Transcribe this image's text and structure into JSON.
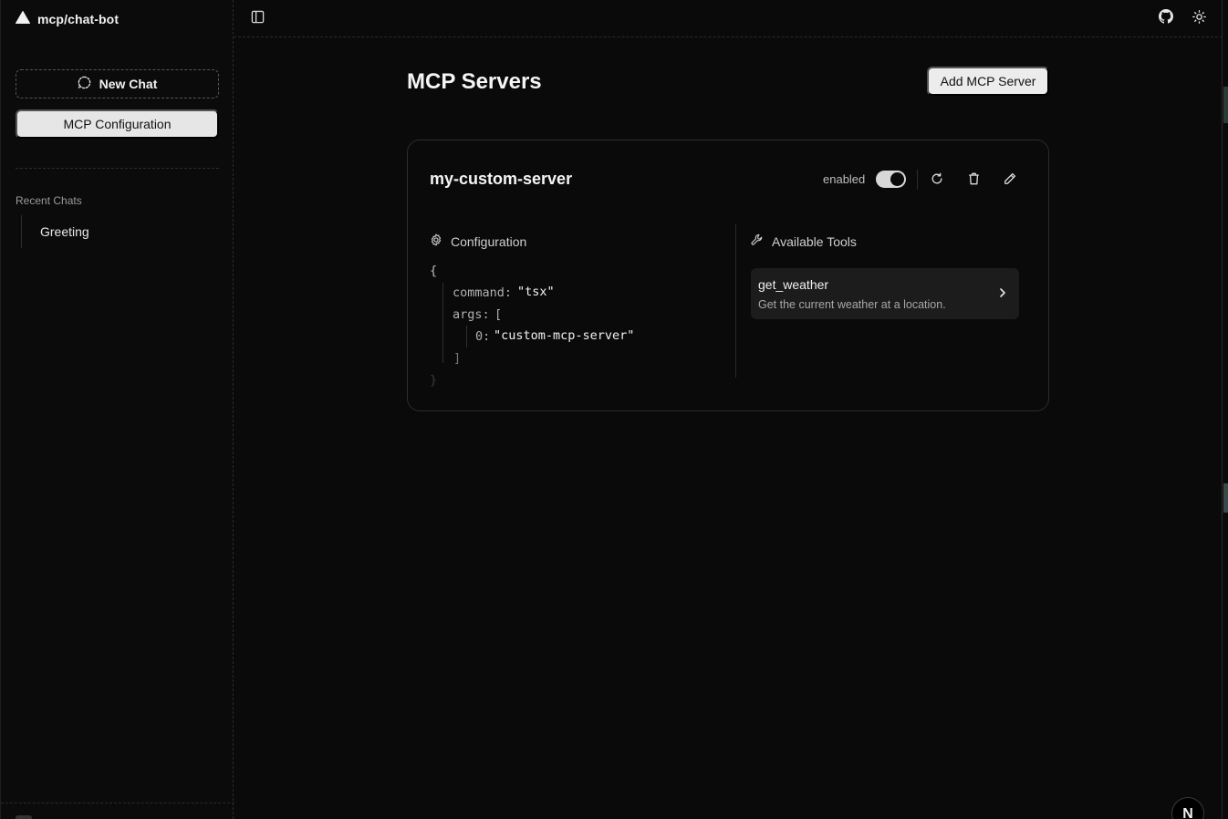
{
  "app": {
    "title": "mcp/chat-bot"
  },
  "sidebar": {
    "new_chat_label": "New Chat",
    "mcp_config_label": "MCP Configuration",
    "recent_label": "Recent Chats",
    "recent_items": [
      {
        "label": "Greeting"
      }
    ]
  },
  "main": {
    "title": "MCP Servers",
    "add_button_label": "Add MCP Server"
  },
  "server": {
    "name": "my-custom-server",
    "status_label": "enabled",
    "enabled": true,
    "configuration_label": "Configuration",
    "tools_label": "Available Tools",
    "config": {
      "open_brace": "{",
      "command_key": "command:",
      "command_value": "\"tsx\"",
      "args_key": "args:",
      "args_open": "[",
      "arg0_key": "0:",
      "arg0_value": "\"custom-mcp-server\"",
      "args_close": "]",
      "close_brace": "}"
    },
    "tools": [
      {
        "name": "get_weather",
        "description": "Get the current weather at a location."
      }
    ]
  },
  "avatar": {
    "initial": "N"
  },
  "icons": {
    "logo": "triangle-logo-icon",
    "new_chat": "dashed-chat-bubble-icon",
    "sidebar_toggle": "sidebar-toggle-icon",
    "github": "github-icon",
    "theme": "sun-icon",
    "refresh": "refresh-icon",
    "delete": "trash-icon",
    "edit": "pencil-icon",
    "settings": "gear-icon",
    "tools": "wrench-icon",
    "chevron": "chevron-right-icon"
  },
  "colors": {
    "background": "#0a0a0a",
    "button_light": "#e6e6e6",
    "tool_card": "#1c1c1c"
  }
}
